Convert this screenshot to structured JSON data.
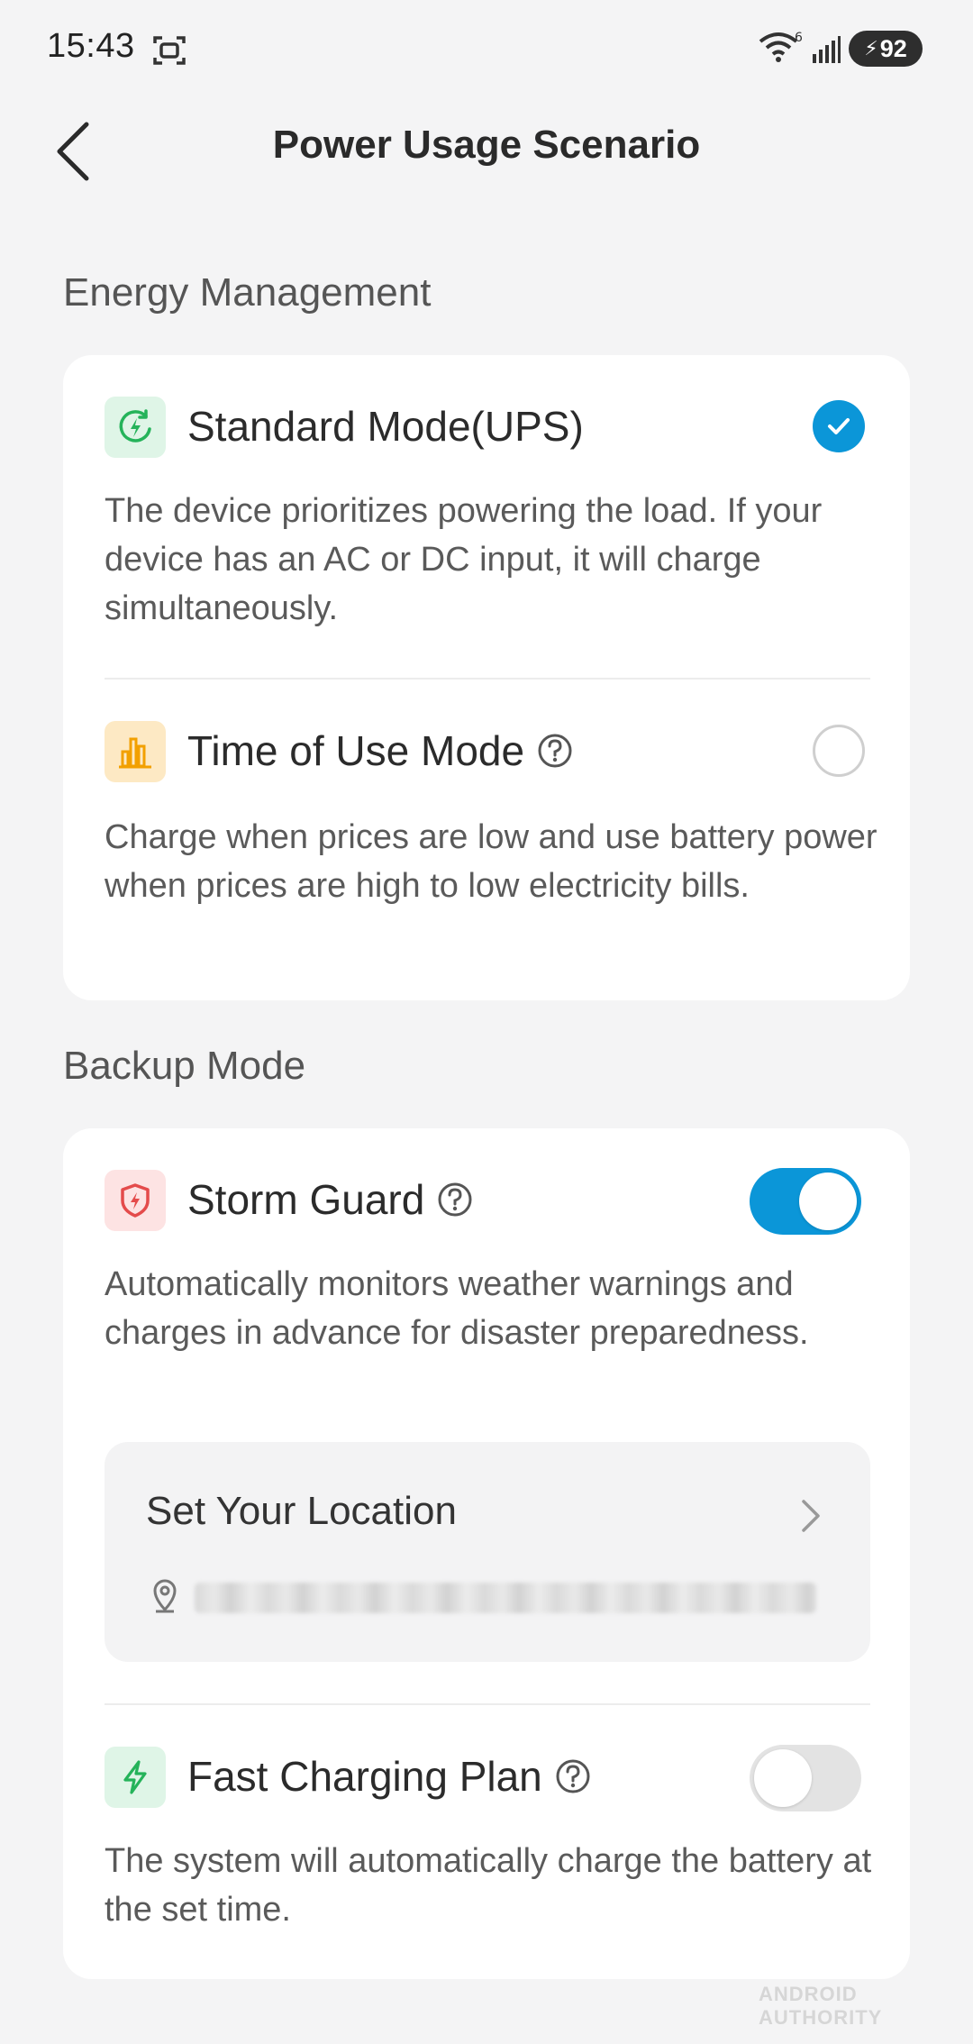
{
  "status_bar": {
    "time": "15:43",
    "wifi_badge": "6",
    "battery_level": "92"
  },
  "header": {
    "title": "Power Usage Scenario"
  },
  "energy_management": {
    "section_title": "Energy Management",
    "options": [
      {
        "title": "Standard Mode(UPS)",
        "description": "The device prioritizes powering the load. If your device has an AC or DC input, it will charge simultaneously.",
        "selected": true,
        "icon": "power-cycle-icon",
        "icon_bg": "#dff5e7",
        "icon_color": "#25b35a"
      },
      {
        "title": "Time of Use Mode",
        "description": "Charge when prices are low and use battery power when prices are high to low electricity bills.",
        "selected": false,
        "icon": "bar-chart-icon",
        "icon_bg": "#fde9c4",
        "icon_color": "#f2a000"
      }
    ]
  },
  "backup_mode": {
    "section_title": "Backup Mode",
    "storm_guard": {
      "title": "Storm Guard",
      "description": "Automatically monitors weather warnings and charges in advance for disaster preparedness.",
      "enabled": true,
      "icon": "shield-bolt-icon",
      "icon_bg": "#fde3e3",
      "icon_color": "#e44b4b"
    },
    "location": {
      "label": "Set Your Location"
    },
    "fast_charging": {
      "title": "Fast Charging Plan",
      "description": "The system will automatically charge the battery at the set time.",
      "enabled": false,
      "icon": "bolt-icon",
      "icon_bg": "#dff5e7",
      "icon_color": "#25b35a"
    }
  },
  "colors": {
    "accent": "#0b96d8",
    "background": "#f4f4f5",
    "card": "#ffffff"
  },
  "watermark": "ANDROID AUTHORITY"
}
